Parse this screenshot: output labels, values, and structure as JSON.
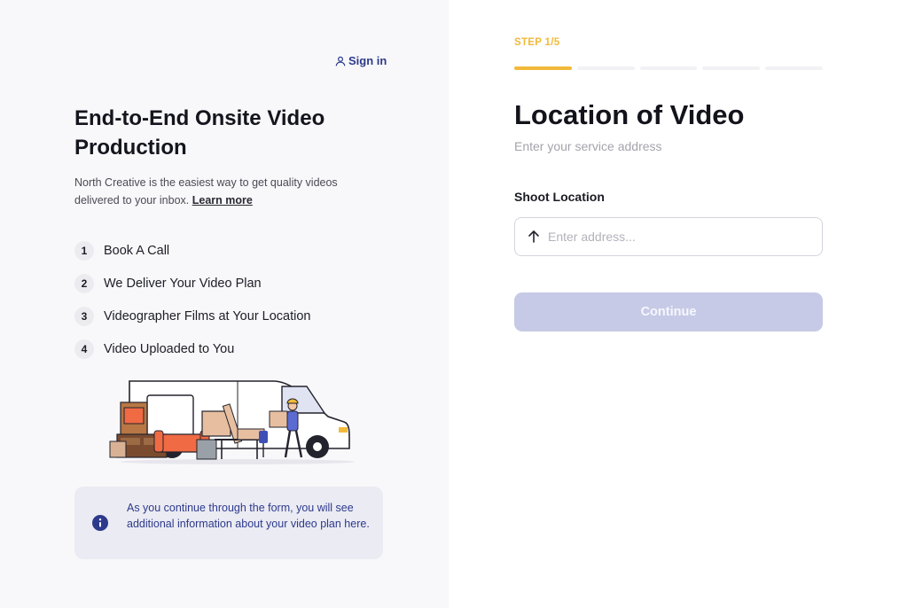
{
  "header": {
    "signin_label": "Sign in"
  },
  "intro": {
    "headline": "End-to-End Onsite Video Production",
    "description": "North Creative is the easiest way to get quality videos delivered to your inbox.",
    "learn_more": "Learn more"
  },
  "steps": [
    {
      "num": "1",
      "label": "Book A Call"
    },
    {
      "num": "2",
      "label": "We Deliver Your Video Plan"
    },
    {
      "num": "3",
      "label": "Videographer Films at Your Location"
    },
    {
      "num": "4",
      "label": "Video Uploaded to You"
    }
  ],
  "info": {
    "text": "As you continue through the form, you will see additional information about your video plan here."
  },
  "form": {
    "step_label": "STEP 1/5",
    "progress": {
      "current": 1,
      "total": 5
    },
    "title": "Location of Video",
    "subtitle": "Enter your service address",
    "field_label": "Shoot Location",
    "address_placeholder": "Enter address...",
    "address_value": "",
    "continue_label": "Continue"
  },
  "colors": {
    "accent": "#f2b93b",
    "brand": "#2d3a8c",
    "button_disabled": "#c6cae6",
    "left_bg": "#f8f8fa"
  },
  "icons": {
    "signin": "user-icon",
    "info": "info-icon",
    "address": "arrow-up-icon"
  }
}
